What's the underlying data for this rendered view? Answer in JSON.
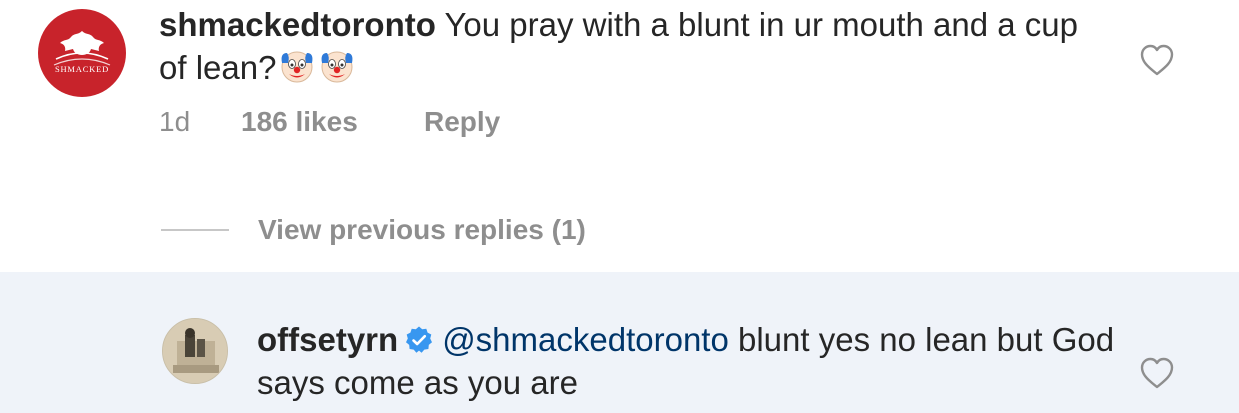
{
  "comment": {
    "avatar_label": "SHMACKED",
    "username": "shmackedtoronto",
    "text": "You pray with a blunt in ur mouth and a cup of lean?",
    "emoji": [
      "clown-face",
      "clown-face"
    ],
    "time": "1d",
    "likes": "186 likes",
    "reply_label": "Reply",
    "heart_icon": "heart-outline-icon"
  },
  "thread": {
    "view_previous_label": "View previous replies (1)"
  },
  "reply": {
    "username": "offsetyrn",
    "verified": true,
    "mention": "@shmackedtoronto",
    "text": " blunt yes no lean but God says come as you are",
    "heart_icon": "heart-outline-icon",
    "background": "#eff3f9"
  }
}
